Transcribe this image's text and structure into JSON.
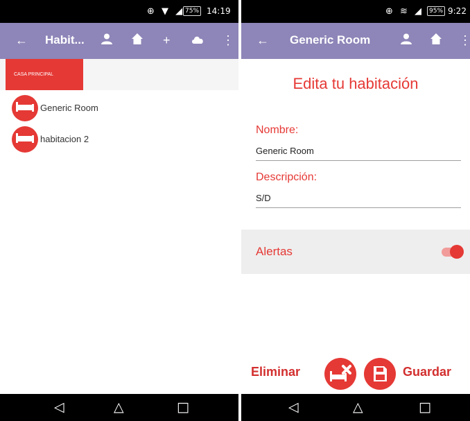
{
  "left_screen": {
    "status_bar": {
      "icons": "⊕ ▼ ◢",
      "battery": "75%",
      "time": "14:19"
    },
    "toolbar": {
      "title": "Habit..."
    },
    "tabs": [
      {
        "label": "CASA PRINCIPAL"
      }
    ],
    "rooms": [
      {
        "name": "Generic Room"
      },
      {
        "name": "habitacion 2"
      }
    ]
  },
  "right_screen": {
    "status_bar": {
      "icons": "⊕ ≋ ◢",
      "battery": "95%",
      "time": "9:22"
    },
    "toolbar": {
      "title": "Generic Room"
    },
    "form": {
      "heading": "Edita tu habitación",
      "name_label": "Nombre:",
      "name_value": "Generic Room",
      "description_label": "Descripción:",
      "description_value": "S/D",
      "alerts_label": "Alertas",
      "alerts_on": true
    },
    "actions": {
      "delete_label": "Eliminar",
      "save_label": "Guardar"
    }
  },
  "colors": {
    "accent": "#e53935",
    "toolbar": "#8e85b8",
    "status_bar": "#000000"
  }
}
